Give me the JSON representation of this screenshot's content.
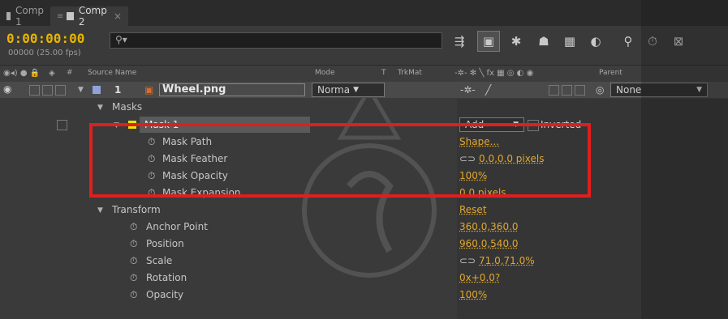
{
  "tabs": [
    {
      "label": "Comp 1",
      "swatch": "#aaaaaa",
      "active": false
    },
    {
      "label": "Comp 2",
      "swatch": "#c8c8c8",
      "active": true
    }
  ],
  "tab_close": "×",
  "timecode": "0:00:00:00",
  "fps_text": "00000 (25.00 fps)",
  "search": {
    "placeholder": "",
    "icon": "search-icon"
  },
  "column_headers": {
    "hash": "#",
    "source_name": "Source Name",
    "mode": "Mode",
    "t": "T",
    "trkmat": "TrkMat",
    "parent": "Parent"
  },
  "layer": {
    "number": "1",
    "name": "Wheel.png",
    "mode": "Norma",
    "parent": "None",
    "label_color": "#8fa3d6"
  },
  "properties": {
    "masks_label": "Masks",
    "mask1": {
      "label": "Mask 1",
      "color": "#f0e000",
      "mode": "Add",
      "inverted_label": "Inverted",
      "rows": [
        {
          "label": "Mask Path",
          "value": "Shape..."
        },
        {
          "label": "Mask Feather",
          "value": "0.0,0.0 pixels"
        },
        {
          "label": "Mask Opacity",
          "value": "100%"
        },
        {
          "label": "Mask Expansion",
          "value": "0.0 pixels"
        }
      ]
    },
    "transform": {
      "label": "Transform",
      "reset_label": "Reset",
      "rows": [
        {
          "label": "Anchor Point",
          "value": "360.0,360.0"
        },
        {
          "label": "Position",
          "value": "960.0,540.0"
        },
        {
          "label": "Scale",
          "value": "71.0,71.0%"
        },
        {
          "label": "Rotation",
          "value": "0x+0.0?"
        },
        {
          "label": "Opacity",
          "value": "100%"
        }
      ]
    }
  },
  "colors": {
    "accent": "#e0a72e",
    "timecode": "#e8b400",
    "highlight": "#e01e1e"
  }
}
